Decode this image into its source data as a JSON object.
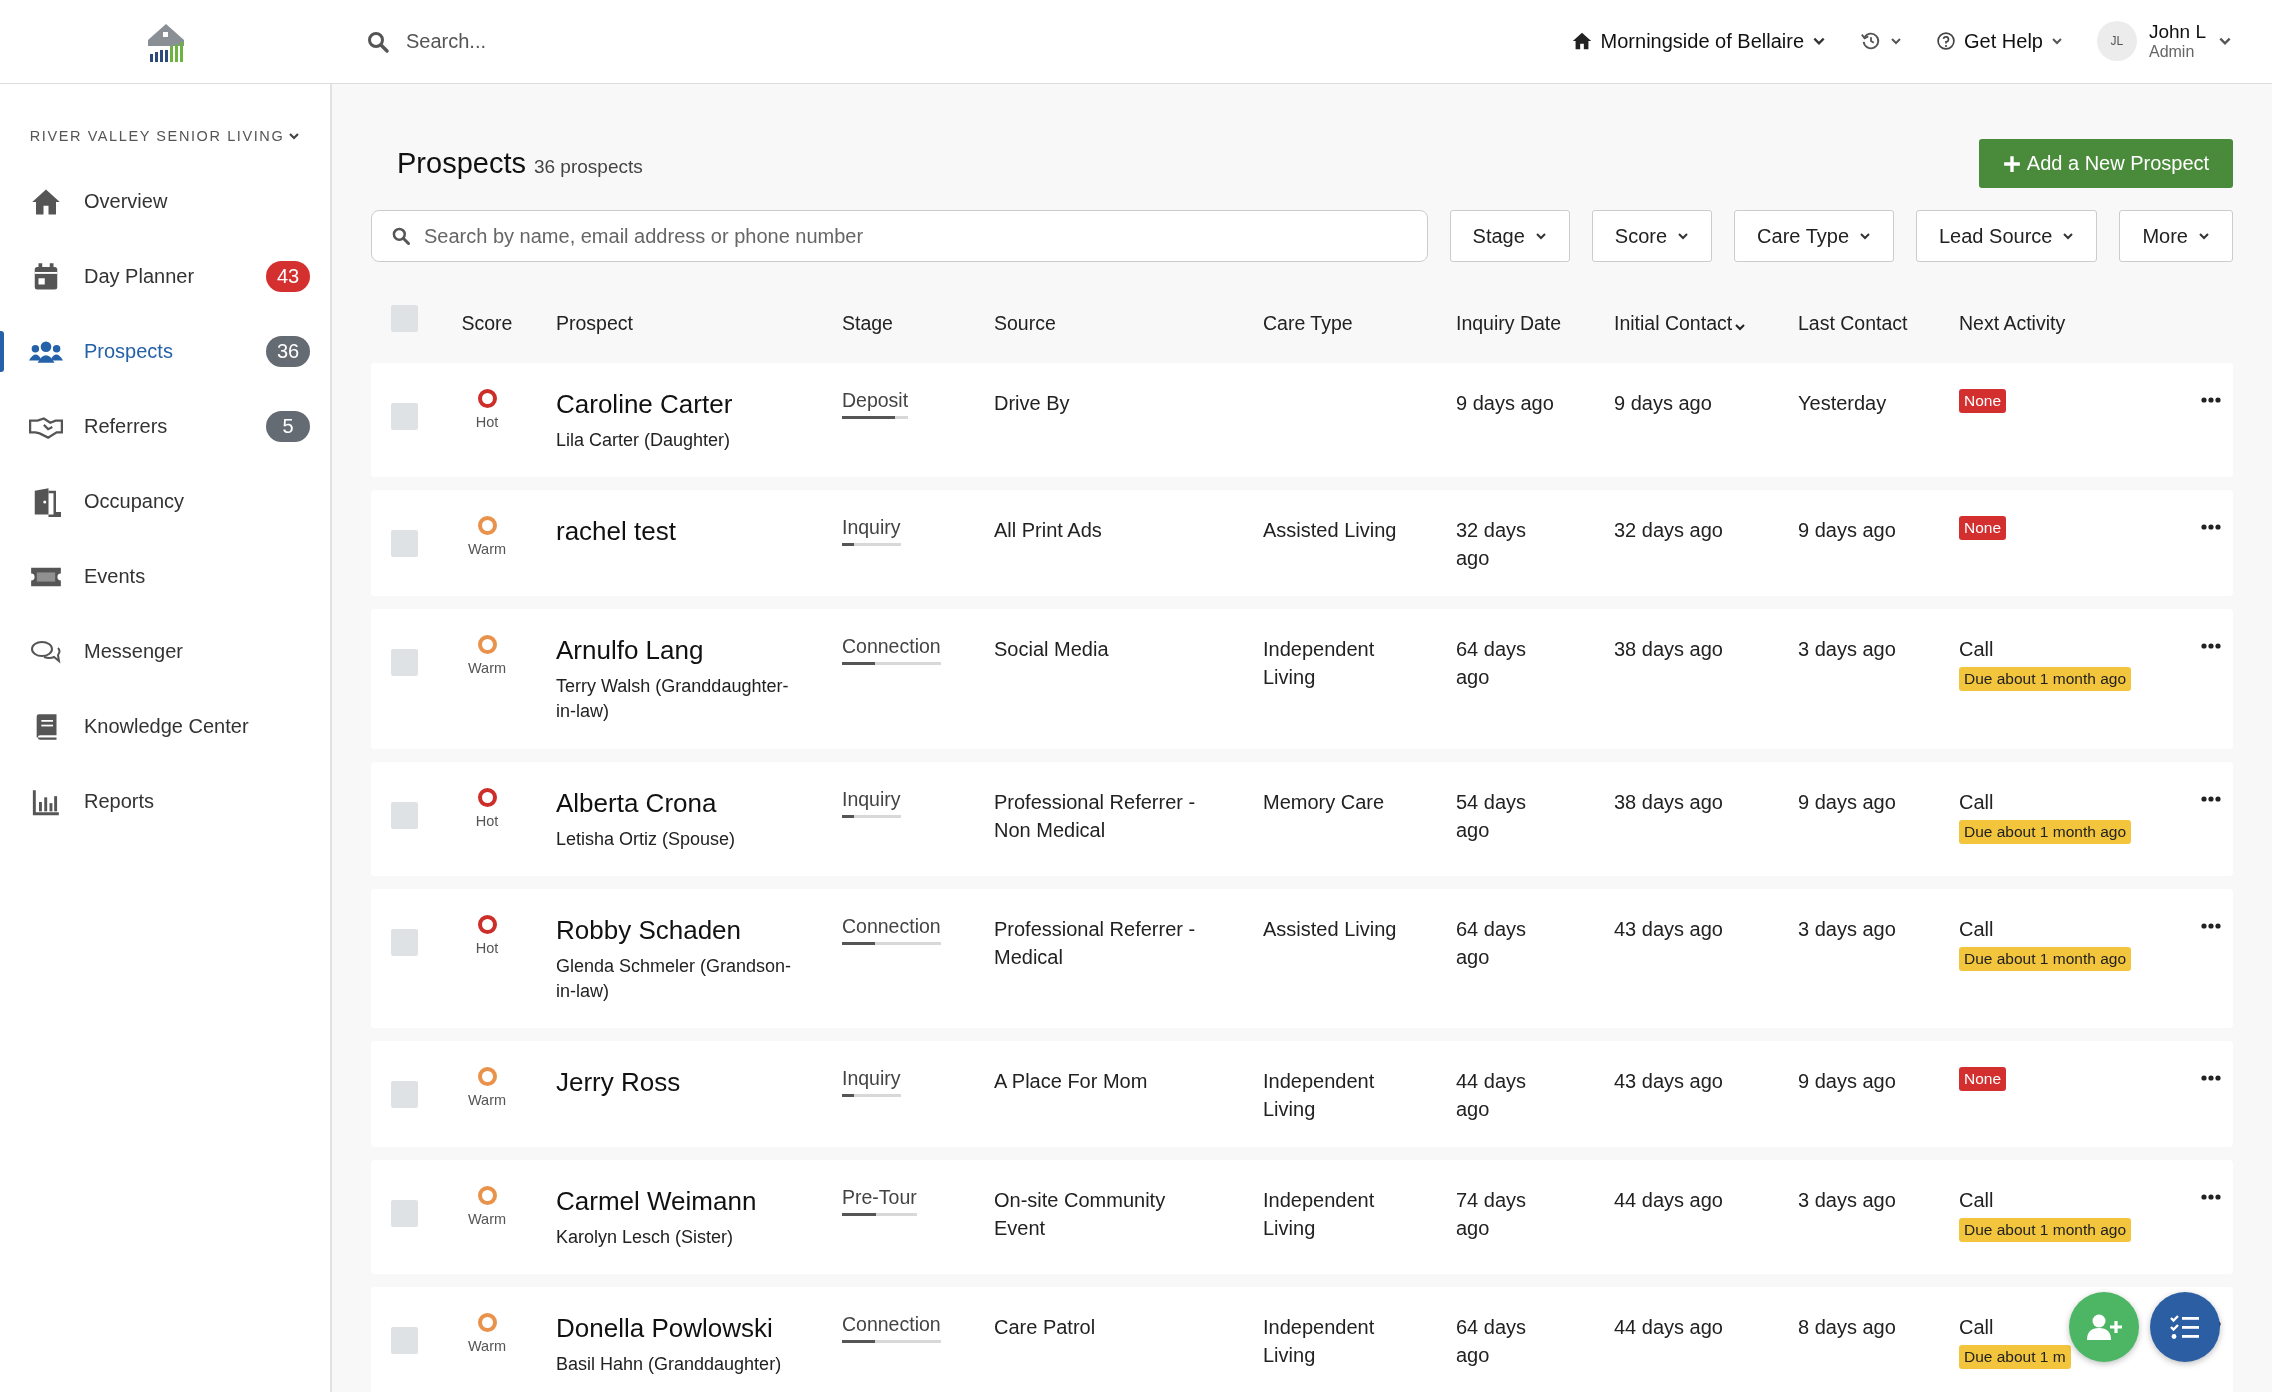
{
  "topbar": {
    "search_placeholder": "Search...",
    "community": "Morningside of Bellaire",
    "help": "Get Help",
    "user": {
      "initials": "JL",
      "name": "John L",
      "role": "Admin"
    }
  },
  "sidebar": {
    "org": "RIVER VALLEY SENIOR LIVING",
    "items": [
      {
        "label": "Overview",
        "selected": false
      },
      {
        "label": "Day Planner",
        "selected": false,
        "badge": {
          "text": "43",
          "color": "#d3302f"
        }
      },
      {
        "label": "Prospects",
        "selected": true,
        "badge": {
          "text": "36",
          "color": "#656b73"
        }
      },
      {
        "label": "Referrers",
        "selected": false,
        "badge": {
          "text": "5",
          "color": "#656b73"
        }
      },
      {
        "label": "Occupancy",
        "selected": false
      },
      {
        "label": "Events",
        "selected": false
      },
      {
        "label": "Messenger",
        "selected": false
      },
      {
        "label": "Knowledge Center",
        "selected": false
      },
      {
        "label": "Reports",
        "selected": false
      }
    ]
  },
  "page": {
    "title": "Prospects",
    "count": "36 prospects",
    "add_button": "Add a New Prospect",
    "search_placeholder": "Search by name, email address or phone number",
    "filters": [
      "Stage",
      "Score",
      "Care Type",
      "Lead Source",
      "More"
    ]
  },
  "table": {
    "header_checked": false,
    "columns": [
      {
        "label": "Score",
        "sorted": false
      },
      {
        "label": "Prospect",
        "sorted": false
      },
      {
        "label": "Stage",
        "sorted": false
      },
      {
        "label": "Source",
        "sorted": false
      },
      {
        "label": "Care Type",
        "sorted": false
      },
      {
        "label": "Inquiry Date",
        "sorted": false
      },
      {
        "label": "Initial Contact",
        "sorted": true
      },
      {
        "label": "Last Contact",
        "sorted": false
      },
      {
        "label": "Next Activity",
        "sorted": false
      }
    ],
    "rows": [
      {
        "checked": false,
        "score": "Hot",
        "color": "#cc2f2a",
        "name": "Caroline Carter",
        "contact": "Lila Carter (Daughter)",
        "stage": "Deposit",
        "level": 0.8,
        "source": "Drive By",
        "care_type": "",
        "inquiry": "9 days ago",
        "initial": "9 days ago",
        "last": "Yesterday",
        "next": {
          "kind": "none",
          "badge": "None"
        }
      },
      {
        "checked": false,
        "score": "Warm",
        "color": "#e8924c",
        "name": "rachel test",
        "stage": "Inquiry",
        "level": 0.2,
        "source": "All Print Ads",
        "care_type": "Assisted Living",
        "inquiry": "32 days ago",
        "initial": "32 days ago",
        "last": "9 days ago",
        "next": {
          "kind": "none",
          "badge": "None"
        }
      },
      {
        "checked": false,
        "score": "Warm",
        "color": "#e8924c",
        "name": "Arnulfo Lang",
        "contact": "Terry Walsh (Granddaughter-in-law)",
        "stage": "Connection",
        "level": 0.33,
        "source": "Social Media",
        "care_type": "Independent Living",
        "inquiry": "64 days ago",
        "initial": "38 days ago",
        "last": "3 days ago",
        "next": {
          "kind": "due",
          "label": "Call",
          "badge": "Due about 1 month ago"
        }
      },
      {
        "checked": false,
        "score": "Hot",
        "color": "#cc2f2a",
        "name": "Alberta Crona",
        "contact": "Letisha Ortiz (Spouse)",
        "stage": "Inquiry",
        "level": 0.2,
        "source": "Professional Referrer - Non Medical",
        "care_type": "Memory Care",
        "inquiry": "54 days ago",
        "initial": "38 days ago",
        "last": "9 days ago",
        "next": {
          "kind": "due",
          "label": "Call",
          "badge": "Due about 1 month ago"
        }
      },
      {
        "checked": false,
        "score": "Hot",
        "color": "#cc2f2a",
        "name": "Robby Schaden",
        "contact": "Glenda Schmeler (Grandson-in-law)",
        "stage": "Connection",
        "level": 0.33,
        "source": "Professional Referrer - Medical",
        "care_type": "Assisted Living",
        "inquiry": "64 days ago",
        "initial": "43 days ago",
        "last": "3 days ago",
        "next": {
          "kind": "due",
          "label": "Call",
          "badge": "Due about 1 month ago"
        }
      },
      {
        "checked": false,
        "score": "Warm",
        "color": "#e8924c",
        "name": "Jerry Ross",
        "stage": "Inquiry",
        "level": 0.2,
        "source": "A Place For Mom",
        "care_type": "Independent Living",
        "inquiry": "44 days ago",
        "initial": "43 days ago",
        "last": "9 days ago",
        "next": {
          "kind": "none",
          "badge": "None"
        }
      },
      {
        "checked": false,
        "score": "Warm",
        "color": "#e8924c",
        "name": "Carmel Weimann",
        "contact": "Karolyn Lesch (Sister)",
        "stage": "Pre-Tour",
        "level": 0.45,
        "source": "On-site Community Event",
        "care_type": "Independent Living",
        "inquiry": "74 days ago",
        "initial": "44 days ago",
        "last": "3 days ago",
        "next": {
          "kind": "due",
          "label": "Call",
          "badge": "Due about 1 month ago"
        }
      },
      {
        "checked": false,
        "score": "Warm",
        "color": "#e8924c",
        "name": "Donella Powlowski",
        "contact": "Basil Hahn (Granddaughter)",
        "stage": "Connection",
        "level": 0.33,
        "source": "Care Patrol",
        "care_type": "Independent Living",
        "inquiry": "64 days ago",
        "initial": "44 days ago",
        "last": "8 days ago",
        "next": {
          "kind": "due",
          "label": "Call",
          "badge": "Due about 1 m"
        }
      }
    ]
  }
}
